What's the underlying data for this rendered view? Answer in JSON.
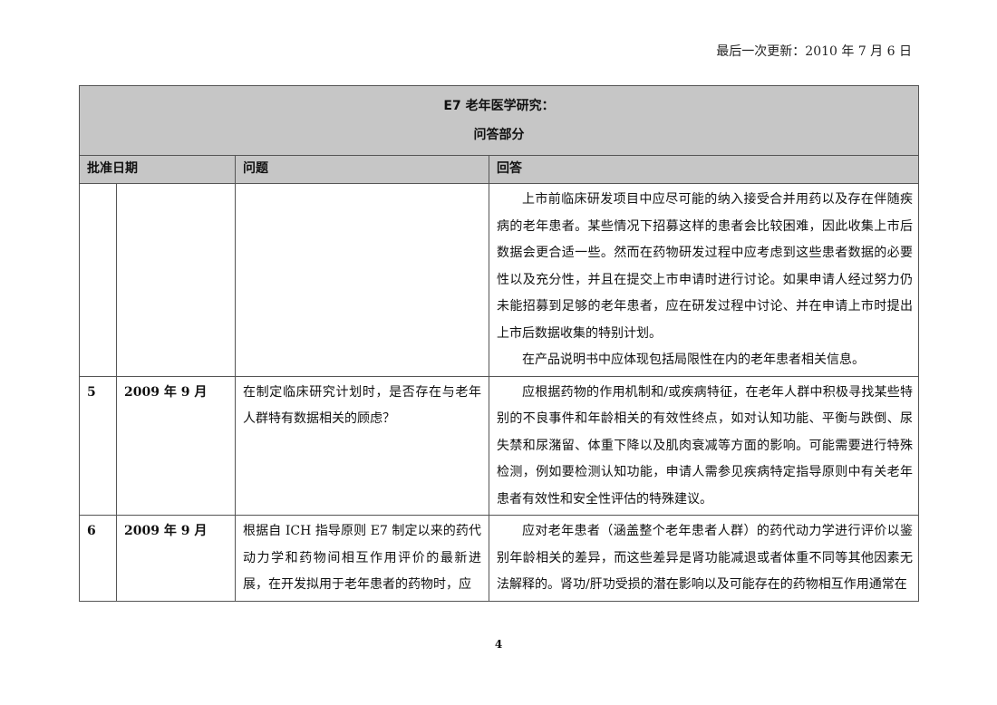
{
  "header": {
    "last_updated": "最后一次更新：2010 年 7 月 6 日"
  },
  "table": {
    "title_line1": "E7 老年医学研究：",
    "title_line2": "问答部分",
    "columns": {
      "approval_date": "批准日期",
      "question": "问题",
      "answer": "回答"
    },
    "rows": [
      {
        "number": "",
        "date": "",
        "question": "",
        "answer_paragraphs": [
          "上市前临床研发项目中应尽可能的纳入接受合并用药以及存在伴随疾病的老年患者。某些情况下招募这样的患者会比较困难，因此收集上市后数据会更合适一些。然而在药物研发过程中应考虑到这些患者数据的必要性以及充分性，并且在提交上市申请时进行讨论。如果申请人经过努力仍未能招募到足够的老年患者，应在研发过程中讨论、并在申请上市时提出上市后数据收集的特别计划。",
          "在产品说明书中应体现包括局限性在内的老年患者相关信息。"
        ]
      },
      {
        "number": "5",
        "date": "2009 年 9 月",
        "question": "在制定临床研究计划时，是否存在与老年人群特有数据相关的顾虑？",
        "answer_paragraphs": [
          "应根据药物的作用机制和/或疾病特征，在老年人群中积极寻找某些特别的不良事件和年龄相关的有效性终点，如对认知功能、平衡与跌倒、尿失禁和尿潴留、体重下降以及肌肉衰减等方面的影响。可能需要进行特殊检测，例如要检测认知功能，申请人需参见疾病特定指导原则中有关老年患者有效性和安全性评估的特殊建议。"
        ]
      },
      {
        "number": "6",
        "date": "2009 年 9 月",
        "question": "根据自 ICH 指导原则 E7 制定以来的药代动力学和药物间相互作用评价的最新进展，在开发拟用于老年患者的药物时，应",
        "answer_paragraphs": [
          "应对老年患者（涵盖整个老年患者人群）的药代动力学进行评价以鉴别年龄相关的差异，而这些差异是肾功能减退或者体重不同等其他因素无法解释的。肾功/肝功受损的潜在影响以及可能存在的药物相互作用通常在"
        ]
      }
    ]
  },
  "footer": {
    "page_number": "4"
  }
}
